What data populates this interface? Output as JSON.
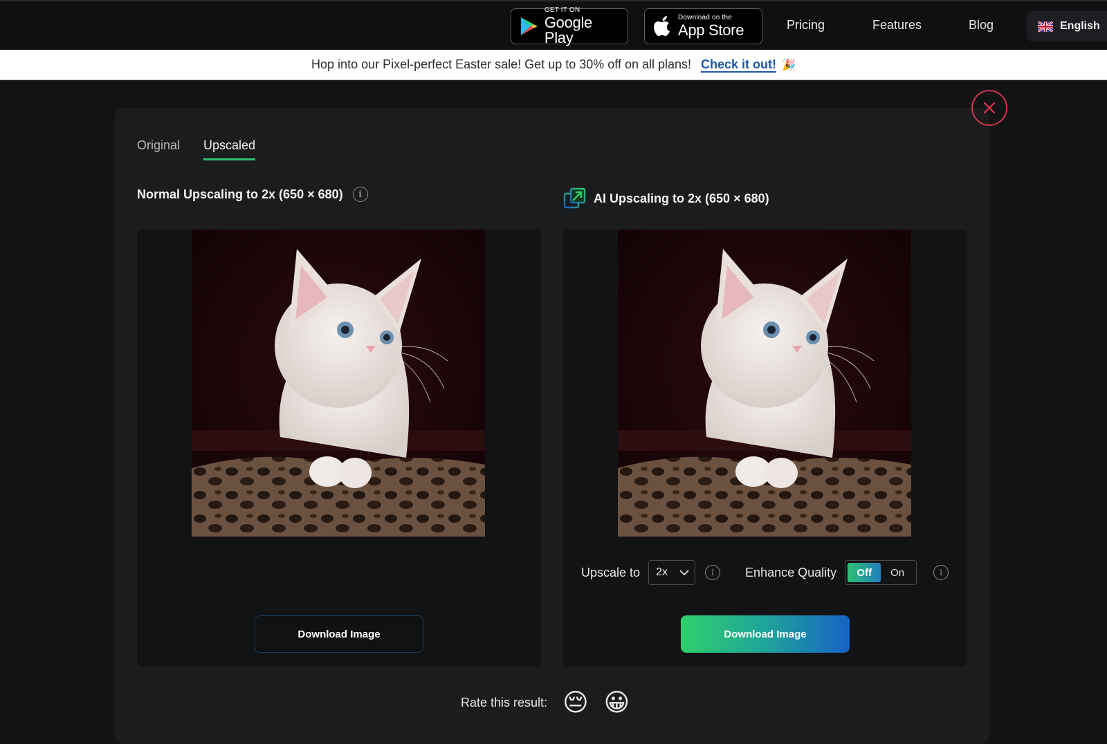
{
  "topnav": {
    "google_play": {
      "small": "GET IT ON",
      "big": "Google Play"
    },
    "app_store": {
      "small": "Download on the",
      "big": "App Store"
    },
    "links": [
      "Pricing",
      "Features",
      "Blog"
    ],
    "language": "English"
  },
  "promo": {
    "text": "Hop into our Pixel-perfect Easter sale! Get up to 30% off on all plans!",
    "link": "Check it out!",
    "emoji": "🎉"
  },
  "tabs": [
    {
      "label": "Original",
      "active": false
    },
    {
      "label": "Upscaled",
      "active": true
    }
  ],
  "left": {
    "title": "Normal Upscaling to 2x (650 × 680)",
    "download": "Download Image"
  },
  "right": {
    "title": "AI Upscaling to 2x (650 × 680)",
    "upscale_label": "Upscale to",
    "upscale_value": "2x",
    "enhance_label": "Enhance Quality",
    "toggle_off": "Off",
    "toggle_on": "On",
    "toggle_selected": "Off",
    "download": "Download Image"
  },
  "rating": {
    "label": "Rate this result:",
    "sad": "😔",
    "happy": "😀"
  },
  "colors": {
    "accent_green": "#2fbf71",
    "accent_blue": "#1763c4",
    "close_red": "#d0344f",
    "link_blue": "#1e56a8"
  }
}
